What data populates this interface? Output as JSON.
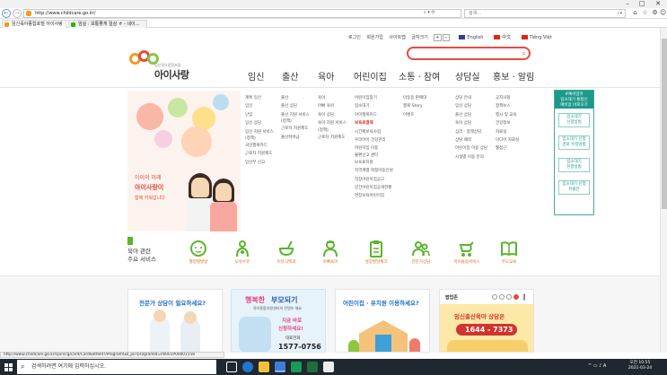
{
  "browser": {
    "url": "http://www.childcare.go.kr/",
    "search_placeholder": "검색...",
    "tabs": [
      {
        "label": "임신육아종합포털 아이사랑",
        "active": true
      },
      {
        "label": "임실 : 보통좋게 일상 ㅎ - 네이..."
      }
    ]
  },
  "util_links": [
    "로그인",
    "회원가입",
    "사이트맵",
    "글자크기"
  ],
  "font_size_controls": [
    "+",
    "−"
  ],
  "languages": [
    "English",
    "中文",
    "Tiếng Việt"
  ],
  "logo": {
    "subtitle": "임신육아종합포털",
    "name": "아이사랑"
  },
  "main_nav": [
    "임신",
    "출산",
    "육아",
    "어린이집",
    "소통 · 참여",
    "상담실",
    "홍보 · 알림"
  ],
  "banner": {
    "line1": "아이의 미래",
    "line2": "아이사랑이",
    "line3": "함께 키워갑니다"
  },
  "menu": {
    "col1": [
      "계획 임신",
      "임신",
      "난임",
      "임신 상담",
      "임신 지원 서비스",
      "(정책)",
      "국민행복카드",
      "근로자 지원제도",
      "임산부 신고"
    ],
    "col2": [
      "출산",
      "출산 상담",
      "출산 지원 서비스",
      "(정책)",
      "근로자 지원제도",
      "출산뒤바금"
    ],
    "col3": [
      "육아",
      "아빠 육아",
      "육아 상담",
      "육아 지원 서비스",
      "(정책)",
      "근로자 지원제도"
    ],
    "col4": [
      "어린이집찾기",
      "입소대기",
      "아이행복카드",
      "보육료결제",
      "시간제보육사업",
      "우리아이 건강관리",
      "어린이집 이용",
      "불편신고 센터",
      "보육료지원",
      "지역계별 적정아동인원",
      "직장어린이집공고",
      "민간어린이집공개현황",
      "연장보육어린이집"
    ],
    "col4_highlight": 3,
    "col5": [
      "아동동 판매대",
      "행복 Story",
      "이벤트"
    ],
    "col6": [
      "상담 안내",
      "임신 상담",
      "출산 상담",
      "육아 상담",
      "심리 · 정책상담",
      "상담 예약",
      "어린이집 이용 상담",
      "시설별 이용 문의"
    ],
    "col7": [
      "공지사항",
      "정책뉴스",
      "행사 및 교육",
      "건강정보",
      "자료실",
      "미디어 자료실",
      "웹접근"
    ]
  },
  "popup": {
    "header": [
      "#예비엄마",
      "입소대기 통합신",
      "예비맘 바로오기"
    ],
    "buttons": [
      [
        "입소대기",
        "신청방법"
      ],
      [
        "입소대기 신청",
        "경로 수정방법"
      ],
      [
        "입소대기",
        "현결방법"
      ],
      [
        "입소대기 신청",
        "취출전"
      ]
    ]
  },
  "services": {
    "title_line1": "육아 관련",
    "title_line2": "주요 서비스",
    "items": [
      "월령별발달",
      "모유수유",
      "이유식백과",
      "아빠육아",
      "성장발달체크",
      "전문가상담",
      "아이돌봄서비스",
      "부모교육"
    ]
  },
  "cards": {
    "expert": "전문가 상담이 필요하세요?",
    "happy_prefix": "행복한",
    "happy_rest": "부모되기",
    "happy_sub": "육아종합지원센터의 컨텐츠 해요",
    "happy_cta1": "지금 바로",
    "happy_cta2": "신청하세요!",
    "happy_phone_label": "대표전화",
    "happy_phone": "1577-0756",
    "kinder": "어린이집 · 유치원 이용하세요?",
    "popupzone_label": "팝업존",
    "popupzone_text": "임신출산육아 상담은",
    "popupzone_phone": "1644 - 7373"
  },
  "status_url": "http://www.childcare.go.kr/cpin/cg/card/CardSettled?/ProgramGB_pl/?programId=P0001P00001558",
  "taskbar": {
    "search_placeholder": "검색하려면 여기에 입력하십시오.",
    "tray_lang": "A",
    "time": "오전 10:55",
    "date": "2021-03-24"
  },
  "colors": {
    "brand_red": "#e84b3c",
    "highlight_red": "#d0342c",
    "popup_teal": "#1b9a8a",
    "service_orange": "#d46b1b",
    "service_green": "#5ab52e"
  }
}
